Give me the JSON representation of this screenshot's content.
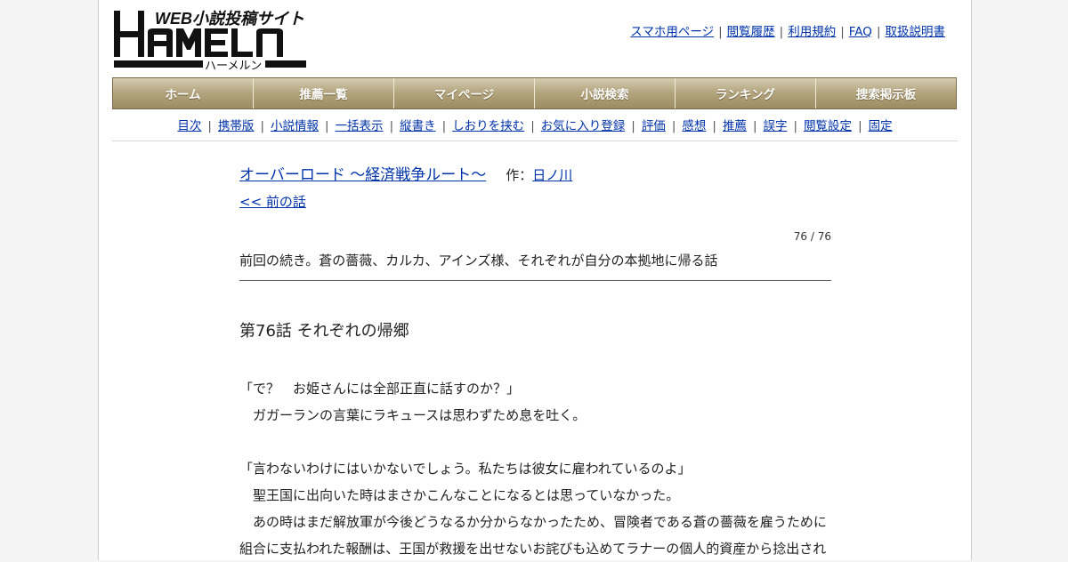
{
  "logo": {
    "tagline": "WEB小説投稿サイト",
    "name": "HAMELN",
    "kana": "ハーメルン"
  },
  "toplinks": [
    "スマホ用ページ",
    "閲覧履歴",
    "利用規約",
    "FAQ",
    "取扱説明書"
  ],
  "mainnav": [
    "ホーム",
    "推薦一覧",
    "マイページ",
    "小説検索",
    "ランキング",
    "捜索掲示板"
  ],
  "subnav": [
    "目次",
    "携帯版",
    "小説情報",
    "一括表示",
    "縦書き",
    "しおりを挟む",
    "お気に入り登録",
    "評価",
    "感想",
    "推薦",
    "誤字",
    "閲覧設定",
    "固定"
  ],
  "novel": {
    "title": "オーバーロード ～経済戦争ルート～",
    "author_prefix": "作：",
    "author": "日ノ川",
    "prev_label": "<< 前の話",
    "page_count": "76 / 76",
    "summary": "前回の続き。蒼の薔薇、カルカ、アインズ様、それぞれが自分の本拠地に帰る話",
    "chapter_title": "第76話 それぞれの帰郷"
  },
  "body": [
    "「で？　お姫さんには全部正直に話すのか？」",
    "　ガガーランの言葉にラキュースは思わずため息を吐く。",
    "",
    "「言わないわけにはいかないでしょう。私たちは彼女に雇われているのよ」",
    "　聖王国に出向いた時はまさかこんなことになるとは思っていなかった。",
    "　あの時はまだ解放軍が今後どうなるか分からなかったため、冒険者である蒼の薔薇を雇うために",
    "組合に支払われた報酬は、王国が救援を出せないお詫びも込めてラナーの個人的資産から捻出され"
  ]
}
